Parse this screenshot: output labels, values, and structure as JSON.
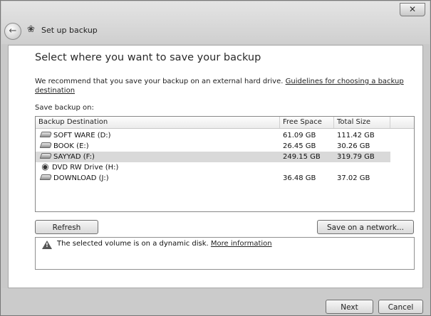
{
  "window": {
    "title": "Set up backup",
    "close_label": "✕"
  },
  "page": {
    "heading": "Select where you want to save your backup",
    "recommend_text": "We recommend that you save your backup on an external hard drive. ",
    "guidelines_link": "Guidelines for choosing a backup destination",
    "save_on_label": "Save backup on:"
  },
  "table": {
    "columns": [
      "Backup Destination",
      "Free Space",
      "Total Size"
    ],
    "rows": [
      {
        "name": "SOFT WARE (D:)",
        "free": "61.09 GB",
        "total": "111.42 GB",
        "icon": "hard-drive-icon"
      },
      {
        "name": "BOOK (E:)",
        "free": "26.45 GB",
        "total": "30.26 GB",
        "icon": "hard-drive-icon"
      },
      {
        "name": "SAYYAD (F:)",
        "free": "249.15 GB",
        "total": "319.79 GB",
        "icon": "hard-drive-icon",
        "selected": true
      },
      {
        "name": "DVD RW Drive (H:)",
        "free": "",
        "total": "",
        "icon": "dvd-drive-icon"
      },
      {
        "name": "DOWNLOAD (J:)",
        "free": "36.48 GB",
        "total": "37.02 GB",
        "icon": "hard-drive-icon"
      }
    ]
  },
  "buttons": {
    "refresh": "Refresh",
    "save_network": "Save on a network...",
    "next": "Next",
    "cancel": "Cancel"
  },
  "info": {
    "message": "The selected volume is on a dynamic disk. ",
    "more_link": "More information",
    "icon": "warning-icon"
  }
}
